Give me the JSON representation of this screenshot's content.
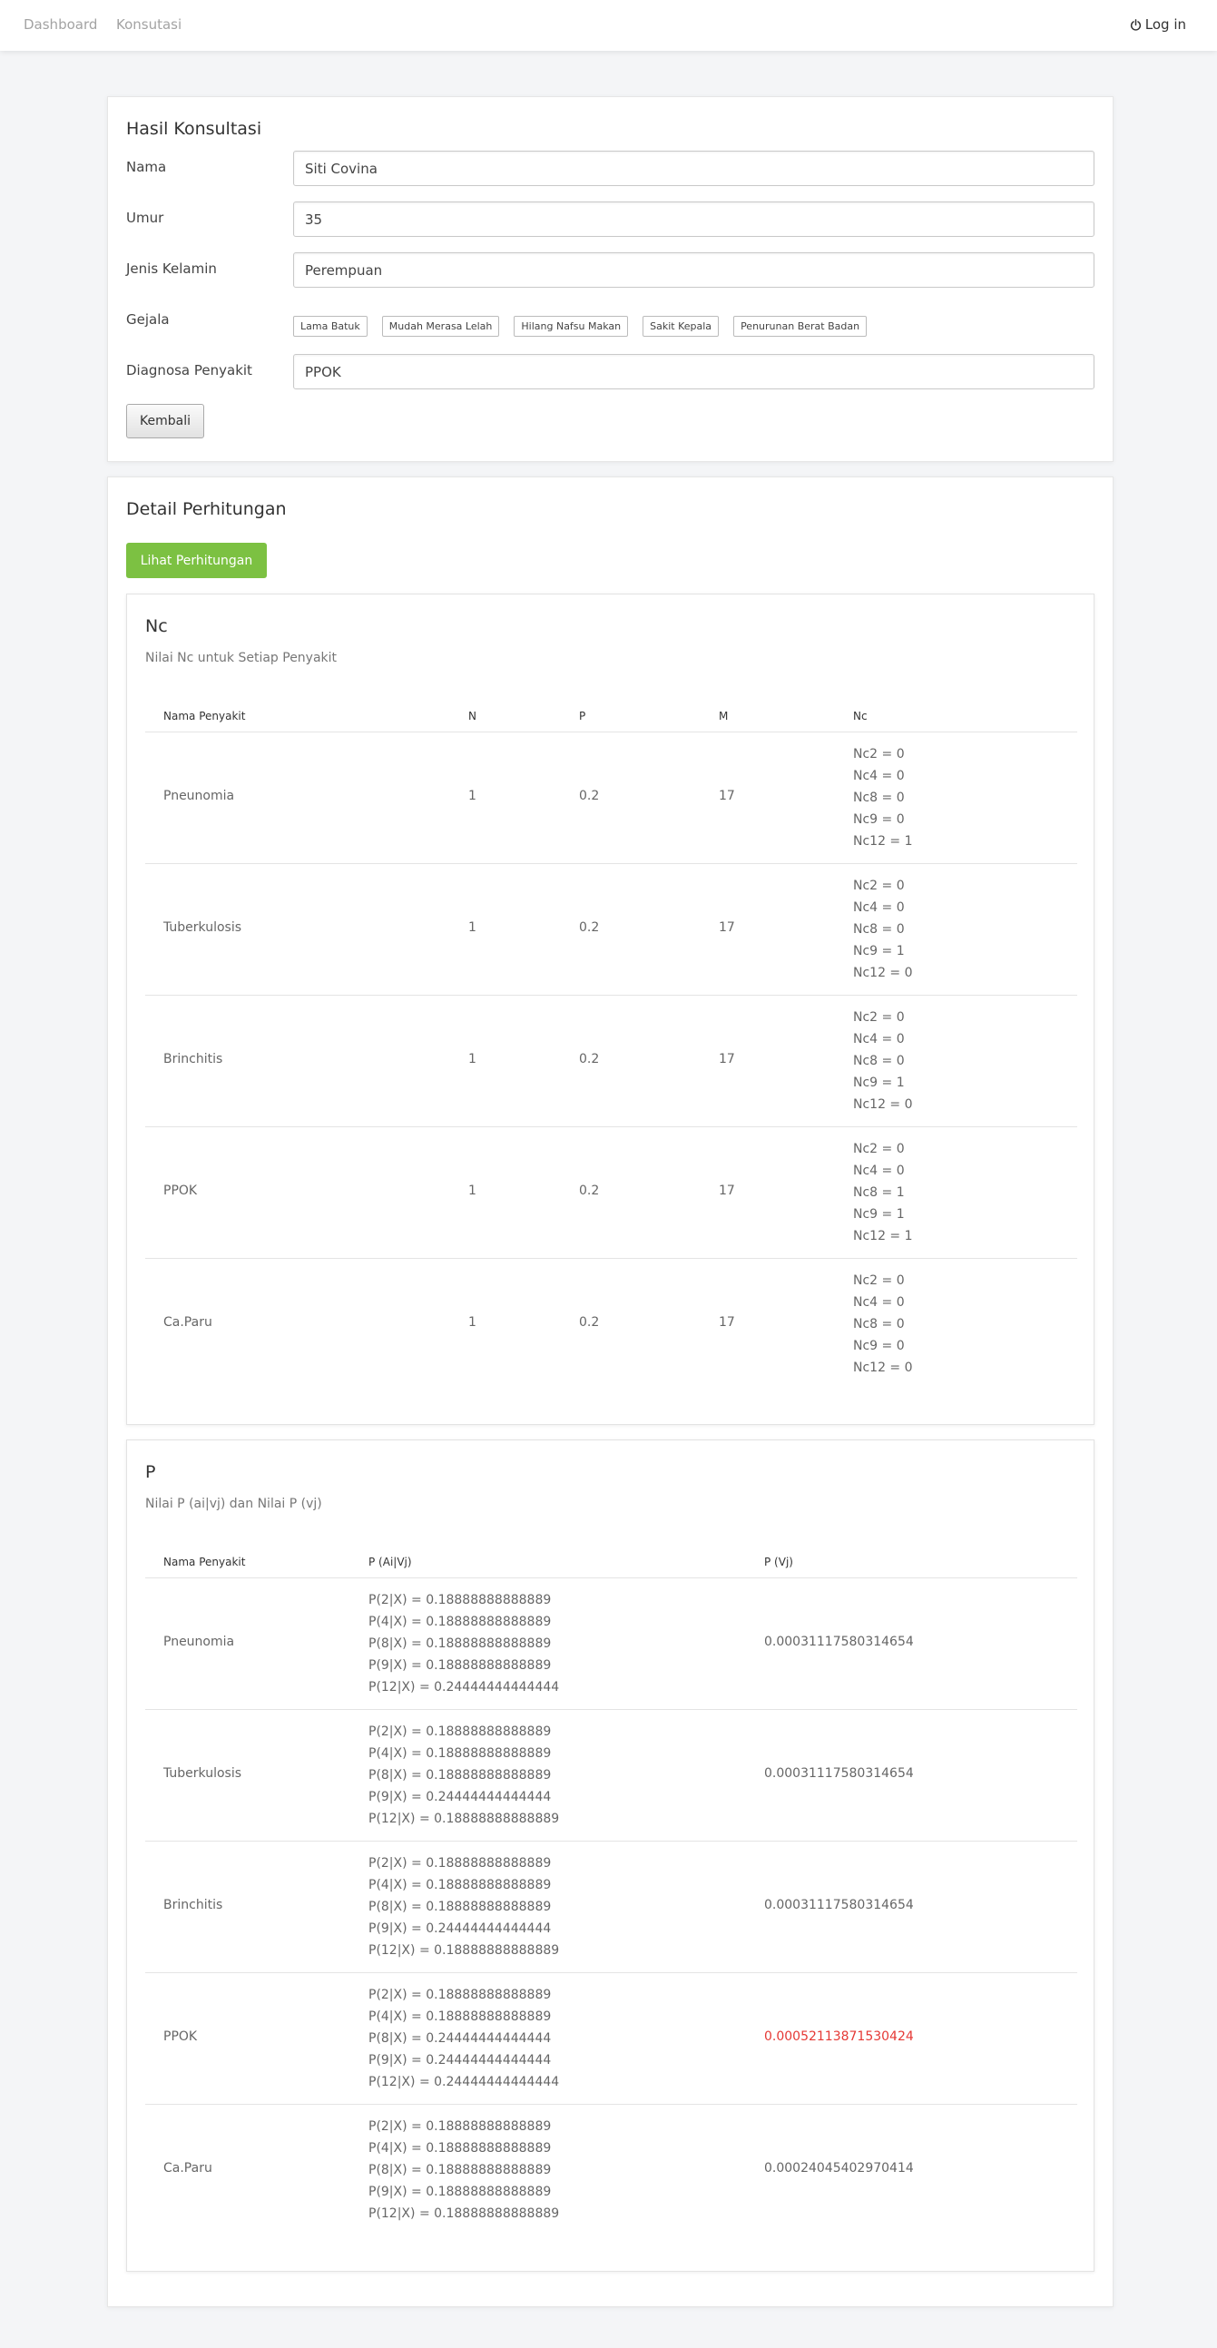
{
  "navbar": {
    "links": [
      "Dashboard",
      "Konsutasi"
    ],
    "login": "Log in"
  },
  "hasil": {
    "title": "Hasil Konsultasi",
    "fields": [
      {
        "label": "Nama",
        "value": "Siti Covina"
      },
      {
        "label": "Umur",
        "value": "35"
      },
      {
        "label": "Jenis Kelamin",
        "value": "Perempuan"
      }
    ],
    "gejala_label": "Gejala",
    "gejala": [
      "Lama Batuk",
      "Mudah Merasa Lelah",
      "Hilang Nafsu Makan",
      "Sakit Kepala",
      "Penurunan Berat Badan"
    ],
    "diagnosa_label": "Diagnosa Penyakit",
    "diagnosa_value": "PPOK",
    "back_button": "Kembali"
  },
  "detail": {
    "title": "Detail Perhitungan",
    "button": "Lihat Perhitungan"
  },
  "nc": {
    "title": "Nc",
    "subtitle": "Nilai Nc untuk Setiap Penyakit",
    "headers": [
      "Nama Penyakit",
      "N",
      "P",
      "M",
      "Nc"
    ],
    "rows": [
      {
        "name": "Pneunomia",
        "n": "1",
        "p": "0.2",
        "m": "17",
        "nc": [
          "Nc2 = 0",
          "Nc4 = 0",
          "Nc8 = 0",
          "Nc9 = 0",
          "Nc12 = 1"
        ]
      },
      {
        "name": "Tuberkulosis",
        "n": "1",
        "p": "0.2",
        "m": "17",
        "nc": [
          "Nc2 = 0",
          "Nc4 = 0",
          "Nc8 = 0",
          "Nc9 = 1",
          "Nc12 = 0"
        ]
      },
      {
        "name": "Brinchitis",
        "n": "1",
        "p": "0.2",
        "m": "17",
        "nc": [
          "Nc2 = 0",
          "Nc4 = 0",
          "Nc8 = 0",
          "Nc9 = 1",
          "Nc12 = 0"
        ]
      },
      {
        "name": "PPOK",
        "n": "1",
        "p": "0.2",
        "m": "17",
        "nc": [
          "Nc2 = 0",
          "Nc4 = 0",
          "Nc8 = 1",
          "Nc9 = 1",
          "Nc12 = 1"
        ]
      },
      {
        "name": "Ca.Paru",
        "n": "1",
        "p": "0.2",
        "m": "17",
        "nc": [
          "Nc2 = 0",
          "Nc4 = 0",
          "Nc8 = 0",
          "Nc9 = 0",
          "Nc12 = 0"
        ]
      }
    ]
  },
  "p": {
    "title": "P",
    "subtitle": "Nilai P (ai|vj) dan Nilai P (vj)",
    "headers": [
      "Nama Penyakit",
      "P (Ai|Vj)",
      "P (Vj)"
    ],
    "highlight_color": "#e53935",
    "rows": [
      {
        "name": "Pneunomia",
        "pai": [
          "P(2|X) = 0.18888888888889",
          "P(4|X) = 0.18888888888889",
          "P(8|X) = 0.18888888888889",
          "P(9|X) = 0.18888888888889",
          "P(12|X) = 0.24444444444444"
        ],
        "pvj": "0.00031117580314654",
        "highlight": false
      },
      {
        "name": "Tuberkulosis",
        "pai": [
          "P(2|X) = 0.18888888888889",
          "P(4|X) = 0.18888888888889",
          "P(8|X) = 0.18888888888889",
          "P(9|X) = 0.24444444444444",
          "P(12|X) = 0.18888888888889"
        ],
        "pvj": "0.00031117580314654",
        "highlight": false
      },
      {
        "name": "Brinchitis",
        "pai": [
          "P(2|X) = 0.18888888888889",
          "P(4|X) = 0.18888888888889",
          "P(8|X) = 0.18888888888889",
          "P(9|X) = 0.24444444444444",
          "P(12|X) = 0.18888888888889"
        ],
        "pvj": "0.00031117580314654",
        "highlight": false
      },
      {
        "name": "PPOK",
        "pai": [
          "P(2|X) = 0.18888888888889",
          "P(4|X) = 0.18888888888889",
          "P(8|X) = 0.24444444444444",
          "P(9|X) = 0.24444444444444",
          "P(12|X) = 0.24444444444444"
        ],
        "pvj": "0.00052113871530424",
        "highlight": true
      },
      {
        "name": "Ca.Paru",
        "pai": [
          "P(2|X) = 0.18888888888889",
          "P(4|X) = 0.18888888888889",
          "P(8|X) = 0.18888888888889",
          "P(9|X) = 0.18888888888889",
          "P(12|X) = 0.18888888888889"
        ],
        "pvj": "0.00024045402970414",
        "highlight": false
      }
    ]
  }
}
